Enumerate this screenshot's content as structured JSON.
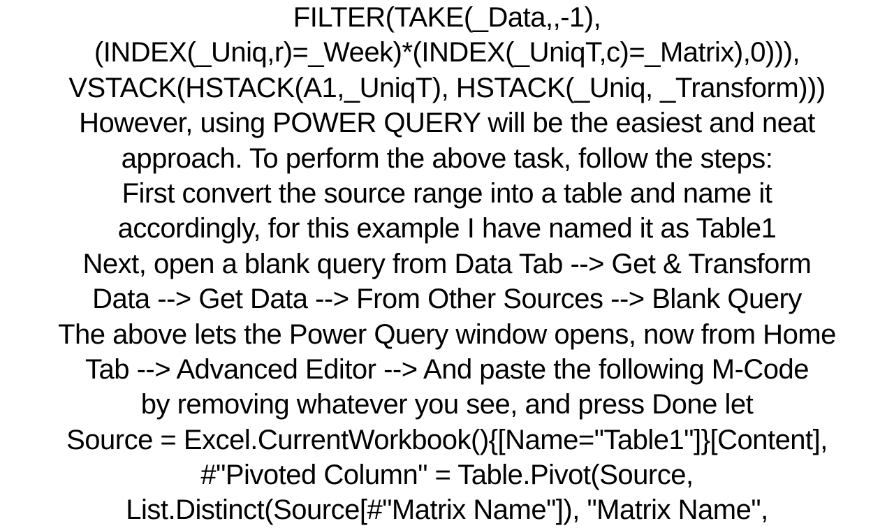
{
  "document": {
    "lines": [
      "FILTER(TAKE(_Data,,-1),",
      "(INDEX(_Uniq,r)=_Week)*(INDEX(_UniqT,c)=_Matrix),0))),",
      "VSTACK(HSTACK(A1,_UniqT), HSTACK(_Uniq, _Transform)))",
      "However, using POWER QUERY will be the easiest and neat",
      "approach.   To perform the above task, follow the steps:",
      "First convert the source range into a table and name it",
      "accordingly, for this example I have named it as Table1",
      "Next, open a blank query from Data Tab --> Get & Transform",
      "Data --> Get Data --> From Other Sources --> Blank Query",
      "The above lets the Power Query window opens, now from Home",
      "Tab --> Advanced Editor --> And paste the following M-Code",
      "by removing whatever you see, and press Done   let",
      "Source = Excel.CurrentWorkbook(){[Name=\"Table1\"]}[Content],",
      "#\"Pivoted Column\" = Table.Pivot(Source,",
      "List.Distinct(Source[#\"Matrix Name\"]), \"Matrix Name\","
    ]
  }
}
